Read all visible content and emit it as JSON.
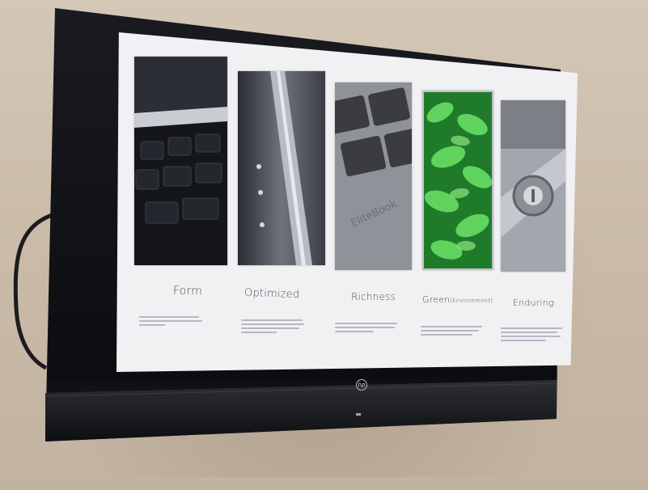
{
  "photo": {
    "subject": "wall-mounted-tv-displaying-slideshow"
  },
  "screen": {
    "panels": [
      {
        "label": "Form",
        "image_icon": "keyboard-closeup-icon",
        "accent": "#1b1d22"
      },
      {
        "label": "Optimized",
        "image_icon": "laptop-hinge-icon",
        "accent": "#5a5e67"
      },
      {
        "label": "Richness",
        "image_icon": "brushed-metal-keys-icon",
        "accent": "#8a8d94"
      },
      {
        "label": "Green",
        "label_suffix": "(Environment)",
        "image_icon": "green-leaves-icon",
        "accent": "#3fb34a"
      },
      {
        "label": "Enduring",
        "image_icon": "metal-hinge-closeup-icon",
        "accent": "#9a9ca3"
      }
    ],
    "background_color": "#f1f1f3"
  },
  "tv": {
    "bezel_color": "#111216",
    "logo_icon": "hp-logo-icon",
    "logo_text": "hp"
  }
}
